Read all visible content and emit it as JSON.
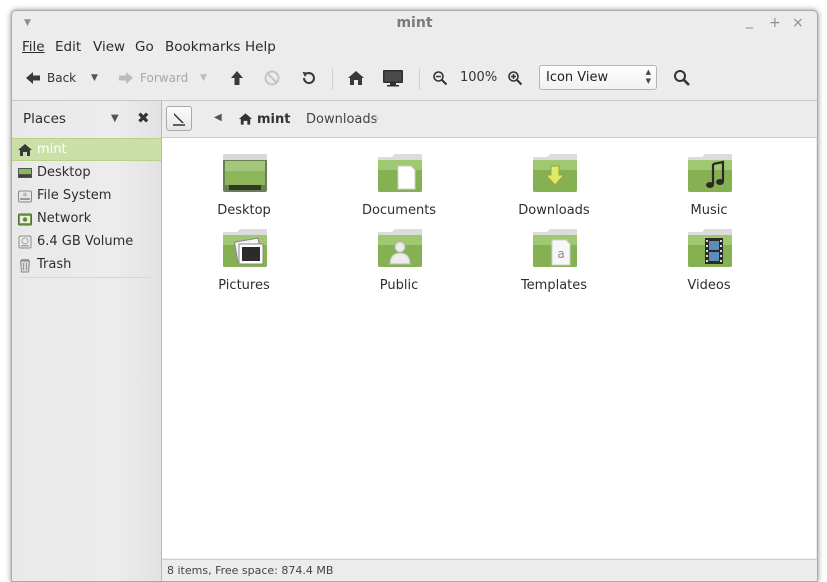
{
  "window": {
    "title": "mint"
  },
  "menubar": {
    "items": [
      {
        "label": "File"
      },
      {
        "label": "Edit"
      },
      {
        "label": "View"
      },
      {
        "label": "Go"
      },
      {
        "label": "Bookmarks"
      },
      {
        "label": "Help"
      }
    ]
  },
  "toolbar": {
    "back_label": "Back",
    "forward_label": "Forward",
    "zoom_label": "100%",
    "view_mode": "Icon View"
  },
  "sidebar": {
    "header": "Places",
    "items": [
      {
        "label": "mint",
        "icon": "home-icon",
        "selected": true
      },
      {
        "label": "Desktop",
        "icon": "desktop-icon"
      },
      {
        "label": "File System",
        "icon": "harddisk-icon"
      },
      {
        "label": "Network",
        "icon": "network-icon"
      },
      {
        "label": "6.4 GB Volume",
        "icon": "drive-icon"
      },
      {
        "label": "Trash",
        "icon": "trash-icon"
      }
    ]
  },
  "pathbar": {
    "crumbs": [
      {
        "label": "mint",
        "icon": "home-icon"
      },
      {
        "label": "Downloads"
      }
    ]
  },
  "files": [
    {
      "name": "Desktop",
      "icon": "desktop-folder-icon"
    },
    {
      "name": "Documents",
      "icon": "documents-folder-icon"
    },
    {
      "name": "Downloads",
      "icon": "downloads-folder-icon"
    },
    {
      "name": "Music",
      "icon": "music-folder-icon"
    },
    {
      "name": "Pictures",
      "icon": "pictures-folder-icon"
    },
    {
      "name": "Public",
      "icon": "public-folder-icon"
    },
    {
      "name": "Templates",
      "icon": "templates-folder-icon"
    },
    {
      "name": "Videos",
      "icon": "videos-folder-icon"
    }
  ],
  "status": {
    "text": "8 items, Free space: 874.4 MB"
  },
  "colors": {
    "accent": "#9bc36b",
    "folder_green": "#86b153",
    "selection": "#cbe0a6"
  }
}
